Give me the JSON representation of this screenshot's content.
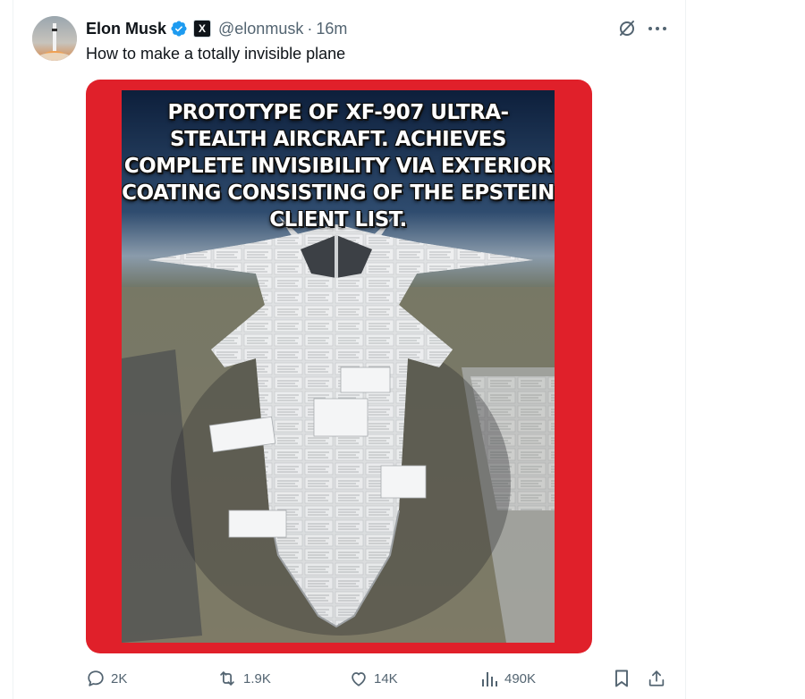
{
  "post": {
    "author": {
      "display_name": "Elon Musk",
      "handle": "@elonmusk",
      "verified": true,
      "affiliation_badge": "X"
    },
    "separator": "·",
    "timestamp": "16m",
    "text": "How to make a totally invisible plane"
  },
  "media": {
    "caption": "PROTOTYPE OF XF-907 ULTRA-STEALTH AIRCRAFT. ACHIEVES COMPLETE INVISIBILITY VIA EXTERIOR COATING CONSISTING OF THE EPSTEIN CLIENT LIST.",
    "frame_color": "#e0202a"
  },
  "actions": {
    "reply_count": "2K",
    "repost_count": "1.9K",
    "like_count": "14K",
    "view_count": "490K"
  },
  "colors": {
    "verified_blue": "#1d9bf0",
    "text_primary": "#0f1419",
    "text_secondary": "#536471"
  },
  "icons": [
    "verified-icon",
    "x-logo-icon",
    "grok-icon",
    "more-icon",
    "reply-icon",
    "repost-icon",
    "like-icon",
    "views-icon",
    "bookmark-icon",
    "share-icon"
  ]
}
